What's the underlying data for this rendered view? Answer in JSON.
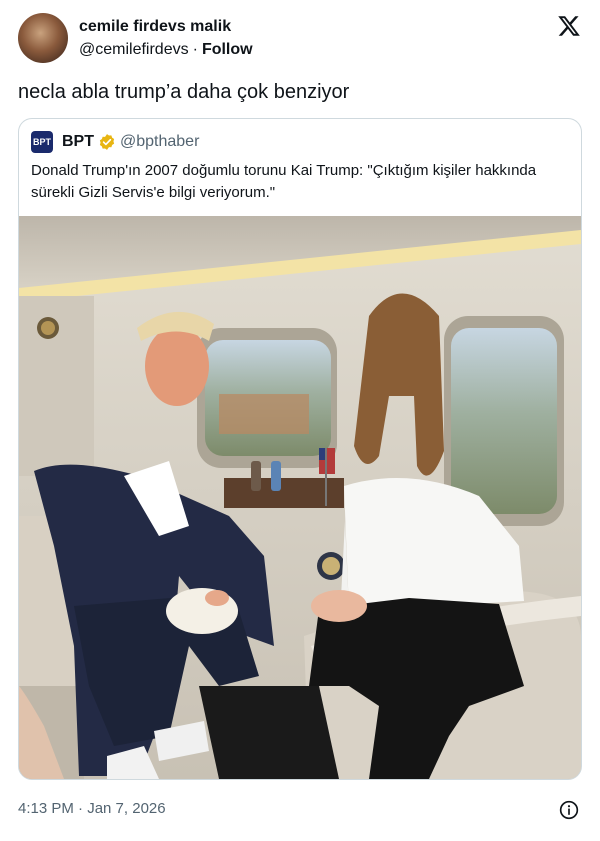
{
  "author": {
    "display_name": "cemile firdevs malik",
    "handle": "@cemilefirdevs",
    "separator": "·",
    "follow_label": "Follow",
    "avatar_icon": "profile-photo"
  },
  "tweet": {
    "text": "necla abla trump’a daha çok benziyor",
    "timestamp": "4:13 PM · Jan 7, 2026"
  },
  "quoted_tweet": {
    "logo_text": "BPT",
    "display_name": "BPT",
    "verified": true,
    "verified_color": "#e8b512",
    "handle": "@bpthaber",
    "text": "Donald Trump'ın 2007 doğumlu torunu Kai Trump: \"Çıktığım kişiler hakkında sürekli Gizli Servis'e bilgi veriyorum.\""
  },
  "icons": {
    "brand": "x-logo-icon",
    "info": "info-icon"
  },
  "colors": {
    "text": "#0f1419",
    "muted": "#536471",
    "border": "#cfd9de"
  }
}
